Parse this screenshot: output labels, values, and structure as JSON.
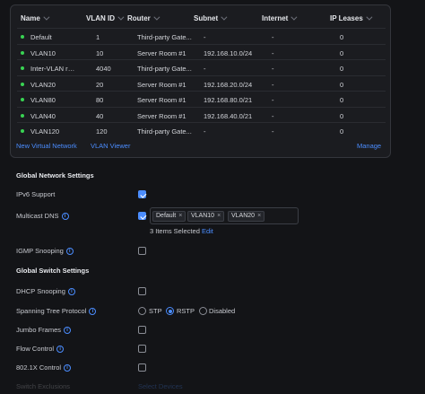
{
  "table": {
    "columns": [
      "Name",
      "VLAN ID",
      "Router",
      "Subnet",
      "Internet",
      "IP Leases"
    ],
    "rows": [
      {
        "name": "Default",
        "vlan": "1",
        "router": "Third-party Gate...",
        "subnet": "-",
        "internet": "-",
        "ip": "0"
      },
      {
        "name": "VLAN10",
        "vlan": "10",
        "router": "Server Room #1",
        "subnet": "192.168.10.0/24",
        "internet": "-",
        "ip": "0"
      },
      {
        "name": "Inter-VLAN rou...",
        "vlan": "4040",
        "router": "Third-party Gate...",
        "subnet": "-",
        "internet": "-",
        "ip": "0"
      },
      {
        "name": "VLAN20",
        "vlan": "20",
        "router": "Server Room #1",
        "subnet": "192.168.20.0/24",
        "internet": "-",
        "ip": "0"
      },
      {
        "name": "VLAN80",
        "vlan": "80",
        "router": "Server Room #1",
        "subnet": "192.168.80.0/21",
        "internet": "-",
        "ip": "0"
      },
      {
        "name": "VLAN40",
        "vlan": "40",
        "router": "Server Room #1",
        "subnet": "192.168.40.0/21",
        "internet": "-",
        "ip": "0"
      },
      {
        "name": "VLAN120",
        "vlan": "120",
        "router": "Third-party Gate...",
        "subnet": "-",
        "internet": "-",
        "ip": "0"
      }
    ]
  },
  "links": {
    "new_network": "New Virtual Network",
    "vlan_viewer": "VLAN Viewer",
    "manage": "Manage"
  },
  "network_settings": {
    "title": "Global Network Settings",
    "ipv6": {
      "label": "IPv6 Support",
      "checked": true
    },
    "multicast": {
      "label": "Multicast DNS",
      "checked": true,
      "tags": [
        "Default",
        "VLAN10",
        "VLAN20"
      ],
      "selected_text": "3 Items Selected",
      "edit": "Edit"
    },
    "igmp": {
      "label": "IGMP Snooping",
      "checked": false
    }
  },
  "switch_settings": {
    "title": "Global Switch Settings",
    "dhcp": {
      "label": "DHCP Snooping",
      "checked": false
    },
    "stp": {
      "label": "Spanning Tree Protocol",
      "options": [
        "STP",
        "RSTP",
        "Disabled"
      ],
      "selected": "RSTP"
    },
    "jumbo": {
      "label": "Jumbo Frames",
      "checked": false
    },
    "flow": {
      "label": "Flow Control",
      "checked": false
    },
    "dot1x": {
      "label": "802.1X Control",
      "checked": false
    },
    "exclusions": {
      "label": "Switch Exclusions",
      "action": "Select Devices"
    }
  },
  "colors": {
    "accent": "#4b8dff",
    "online": "#39d353",
    "background": "#131417",
    "panel": "#1b1c20"
  },
  "icons": {
    "info": "info-icon",
    "status": "status-dot-icon",
    "sort": "chevron-down-icon",
    "remove": "close-icon"
  }
}
